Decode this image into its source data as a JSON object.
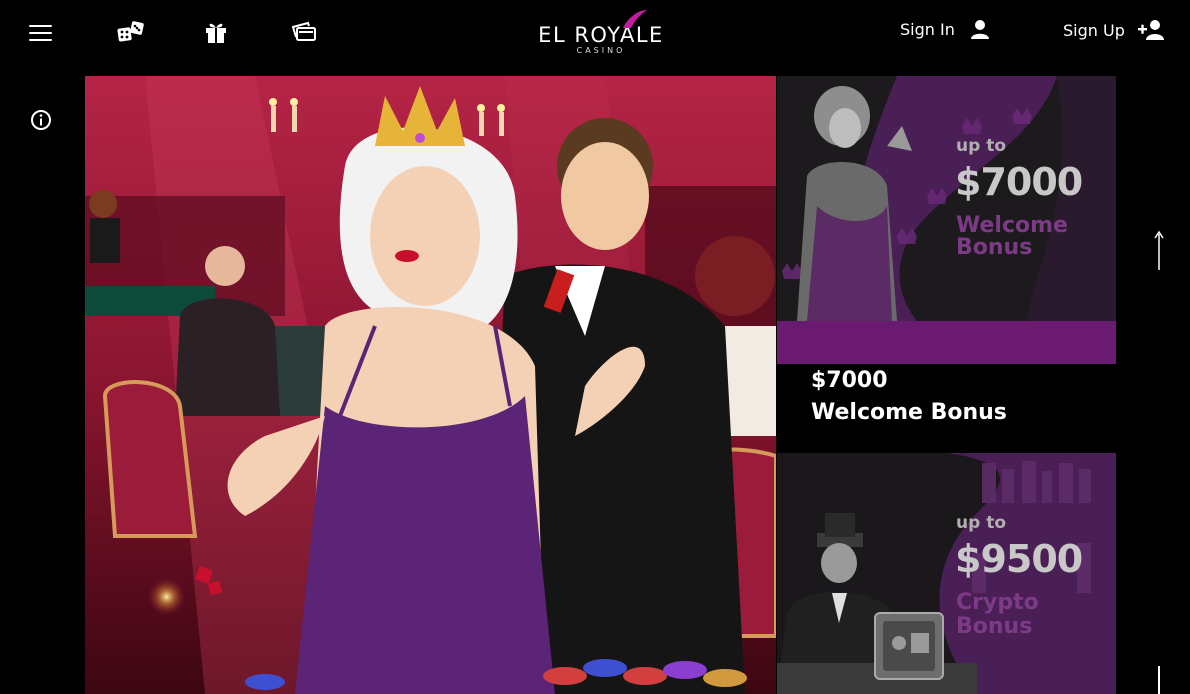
{
  "header": {
    "logo": {
      "main": "EL ROYALE",
      "sub": "CASINO"
    },
    "sign_in_label": "Sign In",
    "sign_up_label": "Sign Up",
    "icons": [
      "hamburger-menu-icon",
      "dice-icon",
      "gift-icon",
      "cards-icon",
      "user-icon",
      "add-user-icon"
    ]
  },
  "sidebar": {
    "info_icon": "info-icon"
  },
  "promos": [
    {
      "art_upto": "up to",
      "art_amount": "$7000",
      "art_label_line1": "Welcome",
      "art_label_line2": "Bonus",
      "title_amount": "$7000",
      "title_name": "Welcome Bonus"
    },
    {
      "art_upto": "up to",
      "art_amount": "$9500",
      "art_label_line1": "Crypto",
      "art_label_line2": "Bonus"
    }
  ],
  "colors": {
    "background": "#000000",
    "promo_bar": "#6b1a72",
    "hero_red": "#8a1530",
    "accent_purple": "#7d3a86"
  }
}
